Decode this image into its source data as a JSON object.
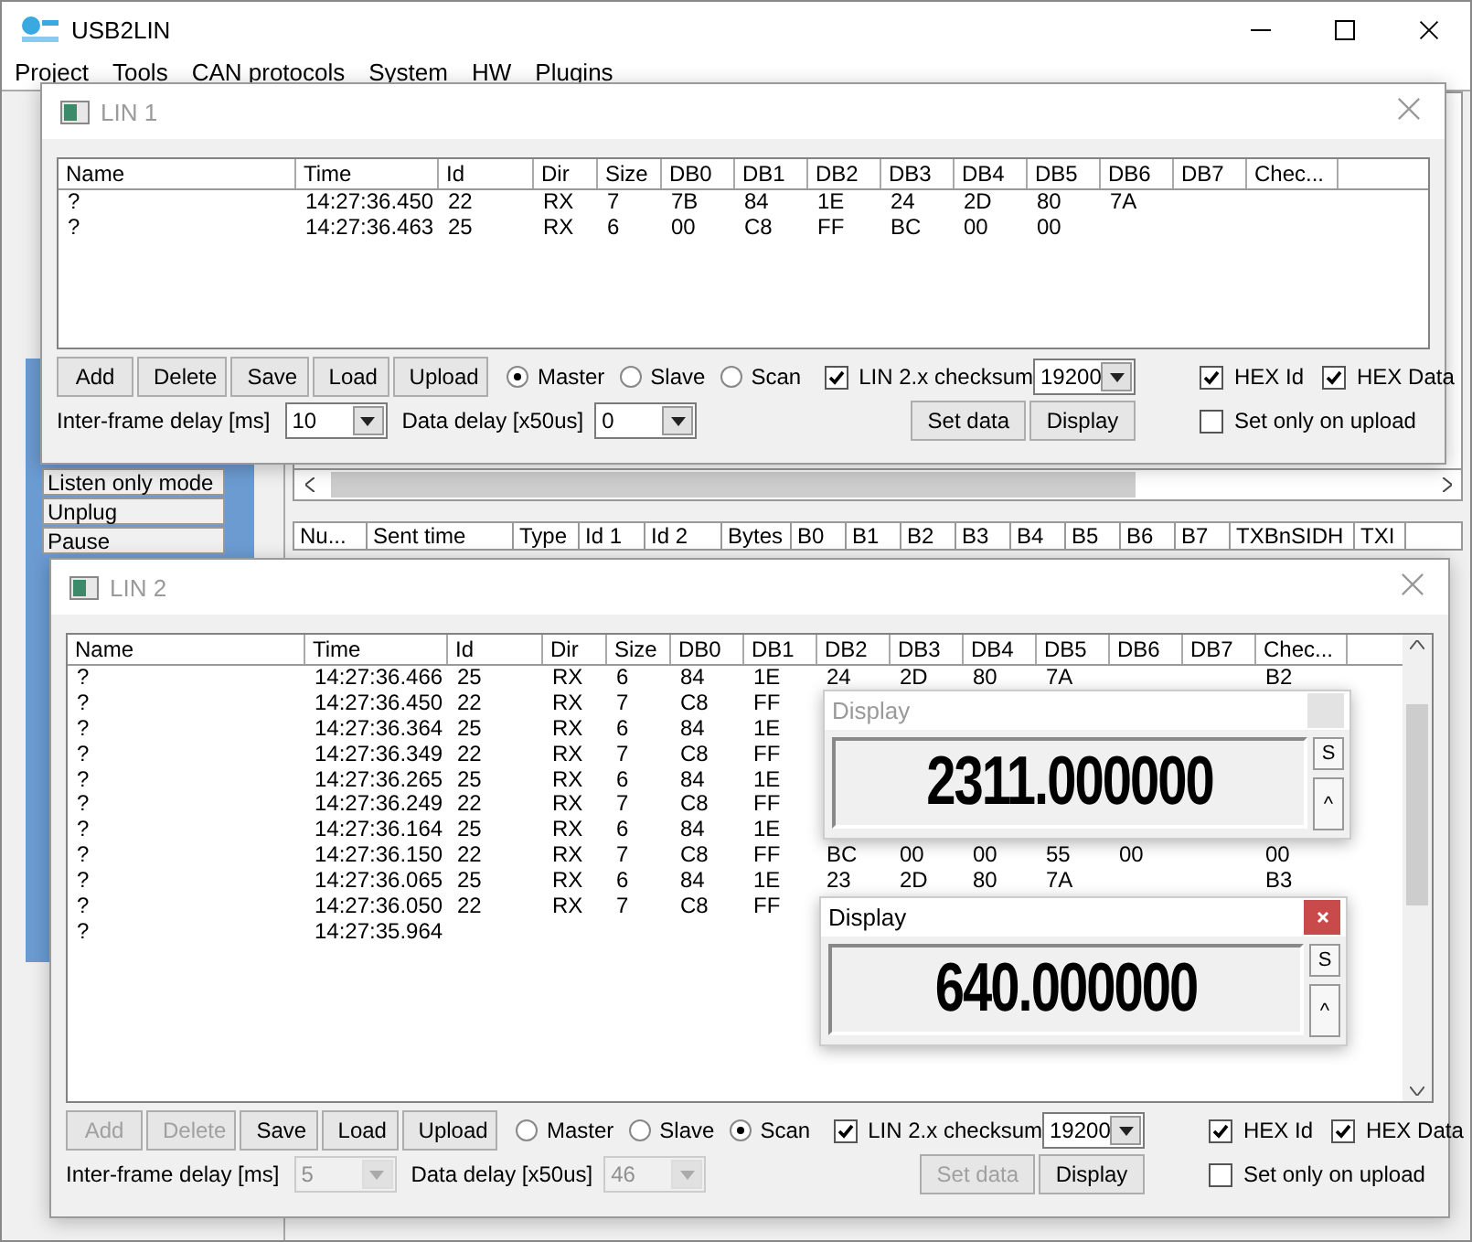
{
  "main_window": {
    "title": "USB2LIN",
    "menu": [
      "Project",
      "Tools",
      "CAN protocols",
      "System",
      "HW",
      "Plugins"
    ],
    "side_buttons": [
      "Listen only mode",
      "Unplug",
      "Pause"
    ],
    "log_columns": [
      "Nu...",
      "Sent time",
      "Type",
      "Id 1",
      "Id 2",
      "Bytes",
      "B0",
      "B1",
      "B2",
      "B3",
      "B4",
      "B5",
      "B6",
      "B7",
      "TXBnSIDH",
      "TXI"
    ]
  },
  "lin_windows": [
    {
      "title": "LIN 1",
      "columns": [
        "Name",
        "Time",
        "Id",
        "Dir",
        "Size",
        "DB0",
        "DB1",
        "DB2",
        "DB3",
        "DB4",
        "DB5",
        "DB6",
        "DB7",
        "Chec..."
      ],
      "rows": [
        {
          "name": "?",
          "time": "14:27:36.450",
          "id": "22",
          "dir": "RX",
          "size": "7",
          "db0": "7B",
          "db1": "84",
          "db2": "1E",
          "db3": "24",
          "db4": "2D",
          "db5": "80",
          "db6": "7A"
        },
        {
          "name": "?",
          "time": "14:27:36.463",
          "id": "25",
          "dir": "RX",
          "size": "6",
          "db0": "00",
          "db1": "C8",
          "db2": "FF",
          "db3": "BC",
          "db4": "00",
          "db5": "00"
        }
      ],
      "buttons": [
        {
          "label": "Add",
          "disabled": false
        },
        {
          "label": "Delete",
          "disabled": false
        },
        {
          "label": "Save",
          "disabled": false
        },
        {
          "label": "Load",
          "disabled": false
        },
        {
          "label": "Upload",
          "disabled": false
        }
      ],
      "modes": [
        {
          "label": "Master",
          "selected": true
        },
        {
          "label": "Slave",
          "selected": false
        },
        {
          "label": "Scan",
          "selected": false
        }
      ],
      "checksum": {
        "label": "LIN 2.x checksum",
        "checked": true
      },
      "baud": "19200",
      "inter_frame": {
        "label": "Inter-frame delay [ms]",
        "value": "10",
        "disabled": false
      },
      "data_delay": {
        "label": "Data delay [x50us]",
        "value": "0",
        "disabled": false
      },
      "set_data": {
        "label": "Set data",
        "disabled": false
      },
      "display_button": "Display",
      "hex_id": {
        "label": "HEX Id",
        "checked": true
      },
      "hex_data": {
        "label": "HEX Data",
        "checked": true
      },
      "set_only_on_upload": {
        "label": "Set only on upload",
        "checked": false
      }
    },
    {
      "title": "LIN 2",
      "columns": [
        "Name",
        "Time",
        "Id",
        "Dir",
        "Size",
        "DB0",
        "DB1",
        "DB2",
        "DB3",
        "DB4",
        "DB5",
        "DB6",
        "DB7",
        "Chec..."
      ],
      "rows": [
        {
          "name": "?",
          "time": "14:27:36.466",
          "id": "25",
          "dir": "RX",
          "size": "6",
          "db0": "84",
          "db1": "1E",
          "db2": "24",
          "db3": "2D",
          "db4": "80",
          "db5": "7A",
          "check": "B2"
        },
        {
          "name": "?",
          "time": "14:27:36.450",
          "id": "22",
          "dir": "RX",
          "size": "7",
          "db0": "C8",
          "db1": "FF"
        },
        {
          "name": "?",
          "time": "14:27:36.364",
          "id": "25",
          "dir": "RX",
          "size": "6",
          "db0": "84",
          "db1": "1E"
        },
        {
          "name": "?",
          "time": "14:27:36.349",
          "id": "22",
          "dir": "RX",
          "size": "7",
          "db0": "C8",
          "db1": "FF"
        },
        {
          "name": "?",
          "time": "14:27:36.265",
          "id": "25",
          "dir": "RX",
          "size": "6",
          "db0": "84",
          "db1": "1E"
        },
        {
          "name": "?",
          "time": "14:27:36.249",
          "id": "22",
          "dir": "RX",
          "size": "7",
          "db0": "C8",
          "db1": "FF"
        },
        {
          "name": "?",
          "time": "14:27:36.164",
          "id": "25",
          "dir": "RX",
          "size": "6",
          "db0": "84",
          "db1": "1E"
        },
        {
          "name": "?",
          "time": "14:27:36.150",
          "id": "22",
          "dir": "RX",
          "size": "7",
          "db0": "C8",
          "db1": "FF",
          "db2": "BC",
          "db3": "00",
          "db4": "00",
          "db5": "55",
          "db6": "00",
          "check": "00"
        },
        {
          "name": "?",
          "time": "14:27:36.065",
          "id": "25",
          "dir": "RX",
          "size": "6",
          "db0": "84",
          "db1": "1E",
          "db2": "23",
          "db3": "2D",
          "db4": "80",
          "db5": "7A",
          "check": "B3"
        },
        {
          "name": "?",
          "time": "14:27:36.050",
          "id": "22",
          "dir": "RX",
          "size": "7",
          "db0": "C8",
          "db1": "FF"
        },
        {
          "name": "?",
          "time": "14:27:35.964"
        }
      ],
      "buttons": [
        {
          "label": "Add",
          "disabled": true
        },
        {
          "label": "Delete",
          "disabled": true
        },
        {
          "label": "Save",
          "disabled": false
        },
        {
          "label": "Load",
          "disabled": false
        },
        {
          "label": "Upload",
          "disabled": false
        }
      ],
      "modes": [
        {
          "label": "Master",
          "selected": false
        },
        {
          "label": "Slave",
          "selected": false
        },
        {
          "label": "Scan",
          "selected": true
        }
      ],
      "checksum": {
        "label": "LIN 2.x checksum",
        "checked": true
      },
      "baud": "19200",
      "inter_frame": {
        "label": "Inter-frame delay [ms]",
        "value": "5",
        "disabled": true
      },
      "data_delay": {
        "label": "Data delay [x50us]",
        "value": "46",
        "disabled": true
      },
      "set_data": {
        "label": "Set data",
        "disabled": true
      },
      "display_button": "Display",
      "hex_id": {
        "label": "HEX Id",
        "checked": true
      },
      "hex_data": {
        "label": "HEX Data",
        "checked": true
      },
      "set_only_on_upload": {
        "label": "Set only on upload",
        "checked": false
      }
    }
  ],
  "displays": [
    {
      "title": "Display",
      "active": false,
      "value": "2311.000000",
      "buttons": [
        "S",
        "^"
      ]
    },
    {
      "title": "Display",
      "active": true,
      "value": "640.000000",
      "buttons": [
        "S",
        "^"
      ]
    }
  ]
}
